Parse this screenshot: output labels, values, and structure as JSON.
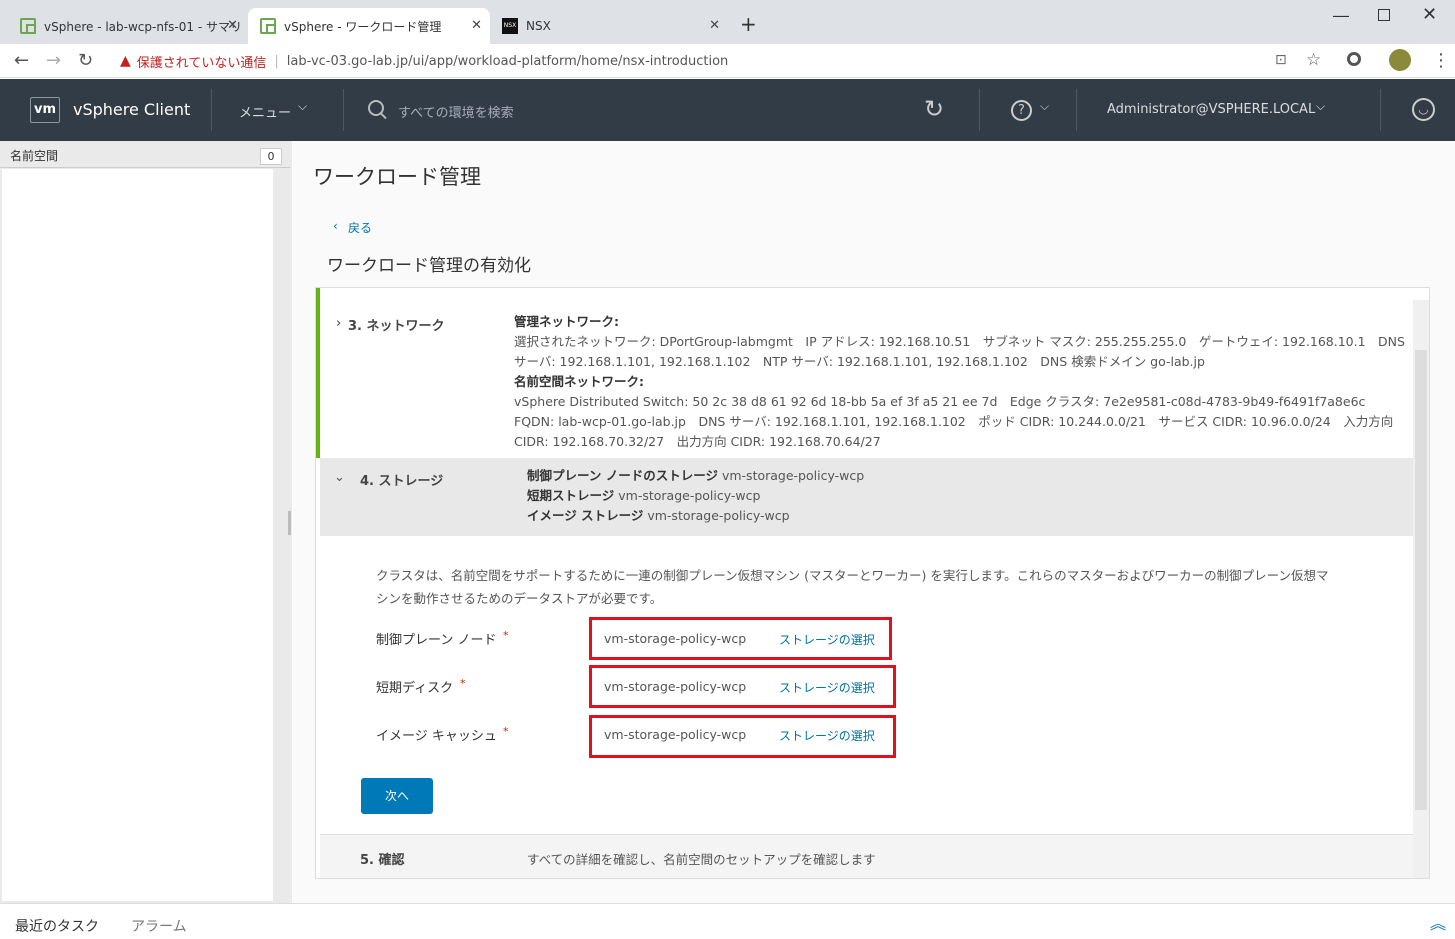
{
  "browser": {
    "tabs": [
      {
        "title": "vSphere - lab-wcp-nfs-01 - サマリ",
        "close": "✕"
      },
      {
        "title": "vSphere - ワークロード管理",
        "close": "✕"
      },
      {
        "title": "NSX",
        "close": "✕"
      }
    ],
    "new_tab": "+",
    "security_label": "保護されていない通信",
    "url": "lab-vc-03.go-lab.jp/ui/app/workload-platform/home/nsx-introduction"
  },
  "header": {
    "logo": "vm",
    "app_name": "vSphere Client",
    "menu_label": "メニュー",
    "search_placeholder": "すべての環境を検索",
    "user": "Administrator@VSPHERE.LOCAL",
    "bg_color": "#313c47"
  },
  "sidebar": {
    "title": "名前空間",
    "count": "0"
  },
  "page": {
    "title": "ワークロード管理",
    "back_label": "戻る",
    "wizard_title": "ワークロード管理の有効化"
  },
  "network_step": {
    "label": "3. ネットワーク",
    "mgmt_heading": "管理ネットワーク:",
    "mgmt_line1": "選択されたネットワーク: DPortGroup-labmgmt　IP アドレス: 192.168.10.51　サブネット マスク: 255.255.255.0　ゲートウェイ: 192.168.10.1　DNS",
    "mgmt_line2": "サーバ: 192.168.1.101, 192.168.1.102　NTP サーバ: 192.168.1.101, 192.168.1.102　DNS 検索ドメイン go-lab.jp",
    "ns_heading": "名前空間ネットワーク:",
    "ns_line1": "vSphere Distributed Switch: 50 2c 38 d8 61 92 6d 18-bb 5a ef 3f a5 21 ee 7d　Edge クラスタ: 7e2e9581-c08d-4783-9b49-f6491f7a8e6c",
    "ns_line2": "FQDN: lab-wcp-01.go-lab.jp　DNS サーバ: 192.168.1.101, 192.168.1.102　ポッド CIDR: 10.244.0.0/21　サービス CIDR: 10.96.0.0/24　入力方向",
    "ns_line3": "CIDR: 192.168.70.32/27　出力方向 CIDR: 192.168.70.64/27"
  },
  "storage_step": {
    "label": "4. ストレージ",
    "summary": [
      {
        "k": "制御プレーン ノードのストレージ",
        "v": "vm-storage-policy-wcp"
      },
      {
        "k": "短期ストレージ",
        "v": "vm-storage-policy-wcp"
      },
      {
        "k": "イメージ ストレージ",
        "v": "vm-storage-policy-wcp"
      }
    ],
    "description_line1": "クラスタは、名前空間をサポートするために一連の制御プレーン仮想マシン (マスターとワーカー) を実行します。これらのマスターおよびワーカーの制御プレーン仮想マ",
    "description_line2": "シンを動作させるためのデータストアが必要です。",
    "fields": [
      {
        "label": "制御プレーン ノード",
        "value": "vm-storage-policy-wcp",
        "action": "ストレージの選択"
      },
      {
        "label": "短期ディスク",
        "value": "vm-storage-policy-wcp",
        "action": "ストレージの選択"
      },
      {
        "label": "イメージ キャッシュ",
        "value": "vm-storage-policy-wcp",
        "action": "ストレージの選択"
      }
    ],
    "required_mark": "*",
    "next_button": "次へ"
  },
  "confirm_step": {
    "label": "5. 確認",
    "description": "すべての詳細を確認し、名前空間のセットアップを確認します"
  },
  "bottom": {
    "tasks": "最近のタスク",
    "alarms": "アラーム"
  }
}
